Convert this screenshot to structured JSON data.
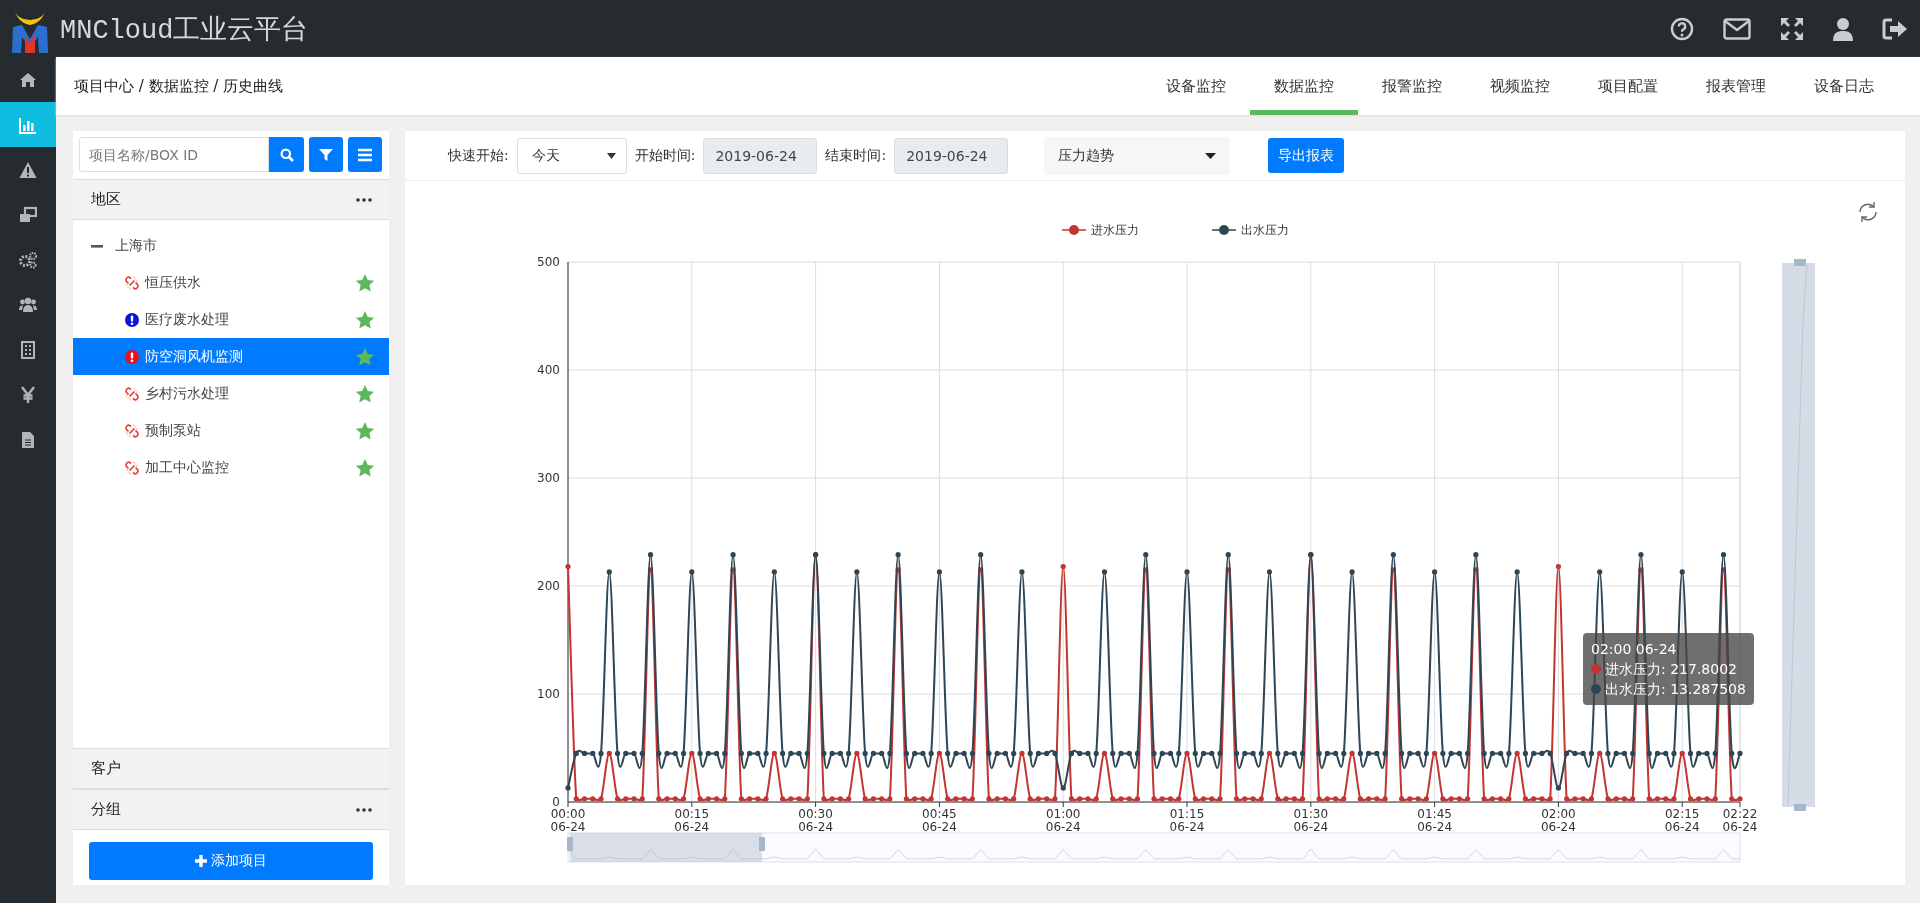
{
  "header": {
    "title": "MNCloud工业云平台"
  },
  "nav": [
    {
      "selected": false
    },
    {
      "selected": true
    },
    {
      "selected": false
    },
    {
      "selected": false
    },
    {
      "selected": false
    },
    {
      "selected": false
    },
    {
      "selected": false
    },
    {
      "selected": false
    },
    {
      "selected": false
    }
  ],
  "breadcrumb": "项目中心 / 数据监控 / 历史曲线",
  "tabs": [
    {
      "label": "设备监控",
      "selected": false
    },
    {
      "label": "数据监控",
      "selected": true
    },
    {
      "label": "报警监控",
      "selected": false
    },
    {
      "label": "视频监控",
      "selected": false
    },
    {
      "label": "项目配置",
      "selected": false
    },
    {
      "label": "报表管理",
      "selected": false
    },
    {
      "label": "设备日志",
      "selected": false
    }
  ],
  "search": {
    "placeholder": "项目名称/BOX ID"
  },
  "tree": {
    "header": "地区",
    "nodes": [
      {
        "label": "上海市",
        "expanded": true,
        "children": [
          {
            "label": "恒压供水",
            "kind": "disconnected",
            "favorite": true,
            "selected": false
          },
          {
            "label": "医疗废水处理",
            "kind": "warning",
            "favorite": true,
            "selected": false
          },
          {
            "label": "防空洞风机监测",
            "kind": "alarm",
            "favorite": true,
            "selected": true
          },
          {
            "label": "乡村污水处理",
            "kind": "disconnected",
            "favorite": true,
            "selected": false
          },
          {
            "label": "预制泵站",
            "kind": "disconnected",
            "favorite": true,
            "selected": false
          },
          {
            "label": "加工中心监控",
            "kind": "disconnected",
            "favorite": true,
            "selected": false
          }
        ]
      }
    ]
  },
  "sections": [
    {
      "label": "客户",
      "menu": false
    },
    {
      "label": "分组",
      "menu": true
    }
  ],
  "add_button": "添加项目",
  "toolbar": {
    "quick_start": {
      "label": "快速开始:",
      "value": "今天"
    },
    "start": {
      "label": "开始时间:",
      "value": "2019-06-24"
    },
    "end": {
      "label": "结束时间:",
      "value": "2019-06-24"
    },
    "metric": "压力趋势",
    "export": "导出报表"
  },
  "chart": {
    "chart_data": {
      "type": "line",
      "grid": true,
      "legend": true,
      "ylim": [
        0,
        500
      ],
      "yticks": [
        0,
        100,
        200,
        300,
        400,
        500
      ],
      "categories": [
        "00:00\n06-24",
        null,
        null,
        null,
        null,
        null,
        null,
        null,
        null,
        null,
        null,
        null,
        null,
        null,
        null,
        "00:15\n06-24",
        null,
        null,
        null,
        null,
        null,
        null,
        null,
        null,
        null,
        null,
        null,
        null,
        null,
        null,
        "00:30\n06-24",
        null,
        null,
        null,
        null,
        null,
        null,
        null,
        null,
        null,
        null,
        null,
        null,
        null,
        null,
        "00:45\n06-24",
        null,
        null,
        null,
        null,
        null,
        null,
        null,
        null,
        null,
        null,
        null,
        null,
        null,
        null,
        "01:00\n06-24",
        null,
        null,
        null,
        null,
        null,
        null,
        null,
        null,
        null,
        null,
        null,
        null,
        null,
        null,
        "01:15\n06-24",
        null,
        null,
        null,
        null,
        null,
        null,
        null,
        null,
        null,
        null,
        null,
        null,
        null,
        null,
        "01:30\n06-24",
        null,
        null,
        null,
        null,
        null,
        null,
        null,
        null,
        null,
        null,
        null,
        null,
        null,
        null,
        "01:45\n06-24",
        null,
        null,
        null,
        null,
        null,
        null,
        null,
        null,
        null,
        null,
        null,
        null,
        null,
        null,
        "02:00\n06-24",
        null,
        null,
        null,
        null,
        null,
        null,
        null,
        null,
        null,
        null,
        null,
        null,
        null,
        null,
        "02:15\n06-24",
        null,
        null,
        null,
        null,
        null,
        null,
        "02:22\n06-24"
      ],
      "series": [
        {
          "name": "进水压力",
          "color": "#c23531",
          "values": [
            218,
            3,
            3,
            3,
            3,
            45,
            3,
            3,
            3,
            3,
            215,
            3,
            3,
            3,
            3,
            45,
            3,
            3,
            3,
            3,
            215,
            3,
            3,
            3,
            3,
            45,
            3,
            3,
            3,
            3,
            229,
            3,
            3,
            3,
            3,
            45,
            3,
            3,
            3,
            3,
            215,
            3,
            3,
            3,
            3,
            45,
            3,
            3,
            3,
            3,
            215,
            3,
            3,
            3,
            3,
            45,
            3,
            3,
            3,
            3,
            218,
            3,
            3,
            3,
            3,
            45,
            3,
            3,
            3,
            3,
            215,
            3,
            3,
            3,
            3,
            45,
            3,
            3,
            3,
            3,
            215,
            3,
            3,
            3,
            3,
            45,
            3,
            3,
            3,
            3,
            229,
            3,
            3,
            3,
            3,
            45,
            3,
            3,
            3,
            3,
            215,
            3,
            3,
            3,
            3,
            45,
            3,
            3,
            3,
            3,
            215,
            3,
            3,
            3,
            3,
            45,
            3,
            3,
            3,
            3,
            218,
            3,
            3,
            3,
            3,
            45,
            3,
            3,
            3,
            3,
            215,
            3,
            3,
            3,
            3,
            45,
            3,
            3,
            3,
            3,
            215,
            3,
            3
          ]
        },
        {
          "name": "出水压力",
          "color": "#2f4554",
          "values": [
            13,
            45,
            45,
            45,
            45,
            213,
            45,
            45,
            45,
            45,
            229,
            45,
            45,
            45,
            45,
            213,
            45,
            45,
            45,
            45,
            229,
            45,
            45,
            45,
            45,
            213,
            45,
            45,
            45,
            45,
            229,
            45,
            45,
            45,
            45,
            213,
            45,
            45,
            45,
            45,
            229,
            45,
            45,
            45,
            45,
            213,
            45,
            45,
            45,
            45,
            229,
            45,
            45,
            45,
            45,
            213,
            45,
            45,
            45,
            45,
            13,
            45,
            45,
            45,
            45,
            213,
            45,
            45,
            45,
            45,
            229,
            45,
            45,
            45,
            45,
            213,
            45,
            45,
            45,
            45,
            229,
            45,
            45,
            45,
            45,
            213,
            45,
            45,
            45,
            45,
            229,
            45,
            45,
            45,
            45,
            213,
            45,
            45,
            45,
            45,
            229,
            45,
            45,
            45,
            45,
            213,
            45,
            45,
            45,
            45,
            229,
            45,
            45,
            45,
            45,
            213,
            45,
            45,
            45,
            45,
            13,
            45,
            45,
            45,
            45,
            213,
            45,
            45,
            45,
            45,
            229,
            45,
            45,
            45,
            45,
            213,
            45,
            45,
            45,
            45,
            229,
            45,
            45
          ]
        }
      ]
    },
    "tooltip": {
      "title": "02:00 06-24",
      "items": [
        {
          "label": "进水压力: 217.8002",
          "color": "#c23531"
        },
        {
          "label": "出水压力: 13.287508",
          "color": "#2f4554"
        }
      ]
    }
  }
}
